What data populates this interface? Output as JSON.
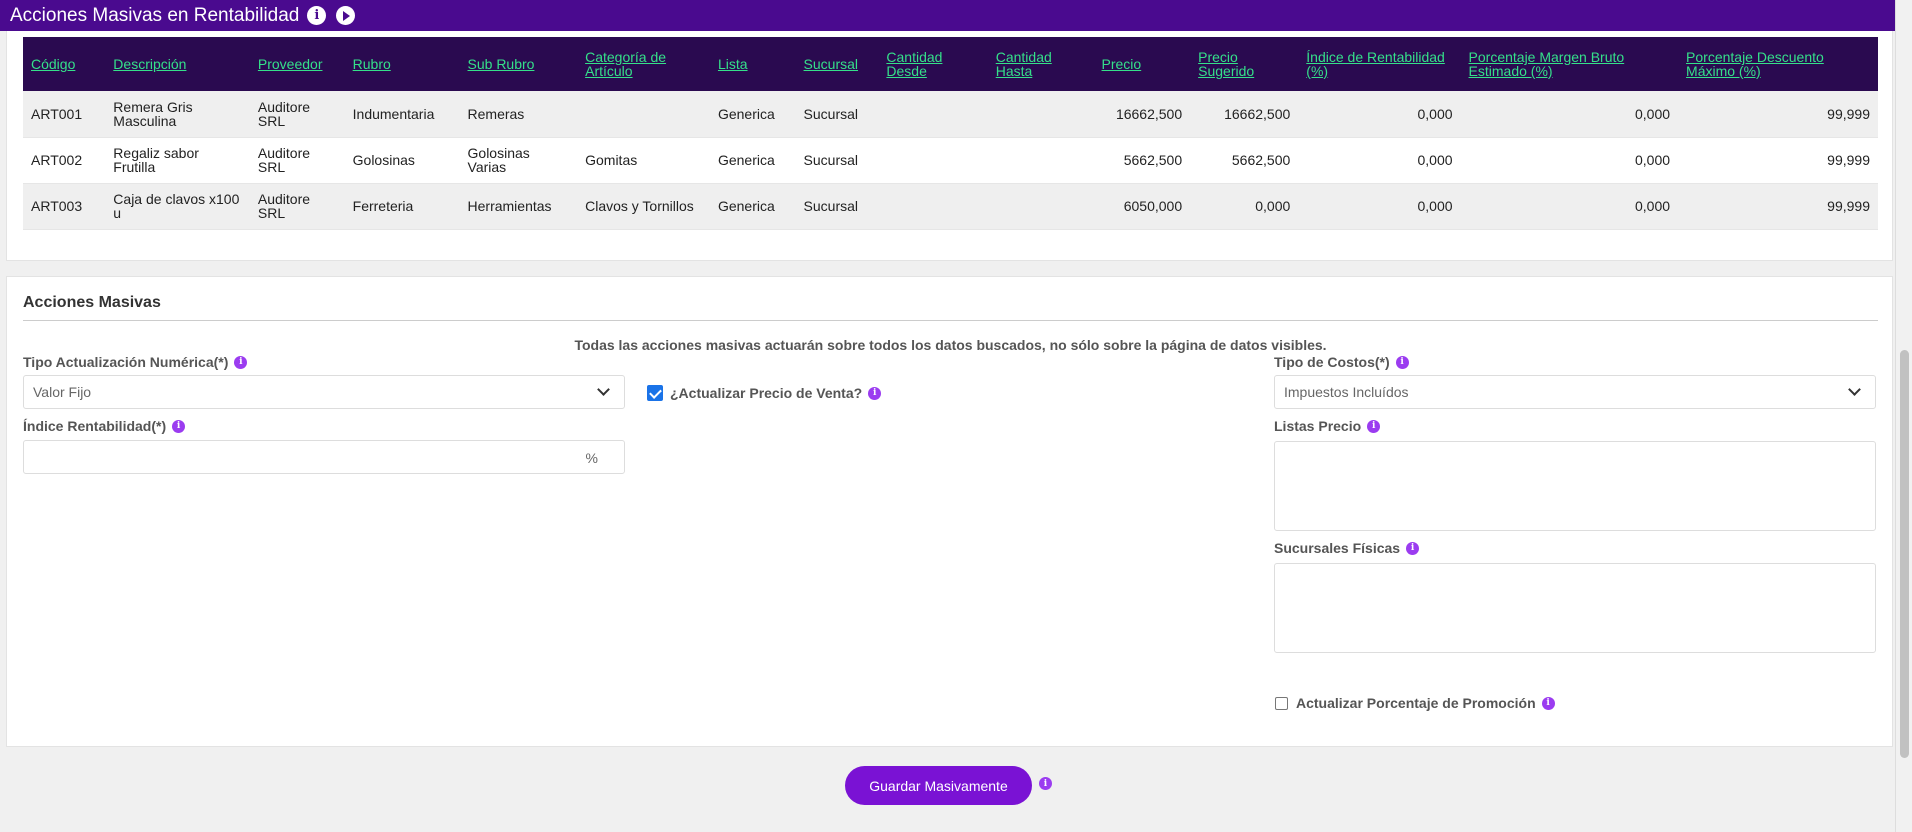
{
  "header": {
    "title": "Acciones Masivas en Rentabilidad",
    "info_icon": "info-icon",
    "play_icon": "play-icon"
  },
  "table": {
    "columns": [
      "Código",
      "Descripción",
      "Proveedor",
      "Rubro",
      "Sub Rubro",
      "Categoría de Artículo",
      "Lista",
      "Sucursal",
      "Cantidad Desde",
      "Cantidad Hasta",
      "Precio",
      "Precio Sugerido",
      "Índice de Rentabilidad (%)",
      "Porcentaje Margen Bruto Estimado (%)",
      "Porcentaje Descuento Máximo (%)"
    ],
    "rows": [
      [
        "ART001",
        "Remera Gris Masculina",
        "Auditore SRL",
        "Indumentaria",
        "Remeras",
        "",
        "Generica",
        "Sucursal",
        "",
        "",
        "16662,500",
        "16662,500",
        "0,000",
        "0,000",
        "99,999"
      ],
      [
        "ART002",
        "Regaliz sabor Frutilla",
        "Auditore SRL",
        "Golosinas",
        "Golosinas Varias",
        "Gomitas",
        "Generica",
        "Sucursal",
        "",
        "",
        "5662,500",
        "5662,500",
        "0,000",
        "0,000",
        "99,999"
      ],
      [
        "ART003",
        "Caja de clavos x100 u",
        "Auditore SRL",
        "Ferreteria",
        "Herramientas",
        "Clavos y Tornillos",
        "Generica",
        "Sucursal",
        "",
        "",
        "6050,000",
        "0,000",
        "0,000",
        "0,000",
        "99,999"
      ]
    ]
  },
  "actions": {
    "title": "Acciones Masivas",
    "notice": "Todas las acciones masivas actuarán sobre todos los datos buscados, no sólo sobre la página de datos visibles.",
    "tipo_actualizacion": {
      "label": "Tipo Actualización Numérica(*)",
      "value": "Valor Fijo"
    },
    "actualizar_precio": {
      "label": "¿Actualizar Precio de Venta?",
      "checked": true
    },
    "tipo_costos": {
      "label": "Tipo de Costos(*)",
      "value": "Impuestos Incluídos"
    },
    "indice_rentabilidad": {
      "label": "Índice Rentabilidad(*)",
      "value": "",
      "suffix": "%"
    },
    "listas_precio": {
      "label": "Listas Precio"
    },
    "sucursales": {
      "label": "Sucursales Físicas"
    },
    "promocion": {
      "label": "Actualizar Porcentaje de Promoción",
      "checked": false
    }
  },
  "footer": {
    "save_label": "Guardar Masivamente"
  },
  "colors": {
    "header_bg": "#4a0a8f",
    "table_head_bg": "#2a0a50",
    "table_head_text": "#35e08a",
    "button_bg": "#7a12d4",
    "info_icon": "#9b3cf0"
  }
}
